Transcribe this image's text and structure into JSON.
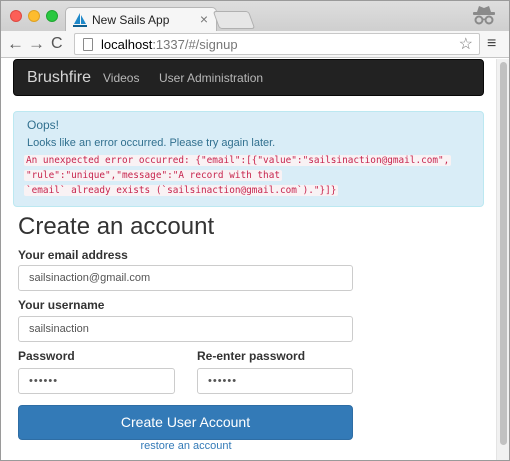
{
  "browser": {
    "tab_title": "New Sails App",
    "tab_close": "×",
    "url_host": "localhost",
    "url_rest": ":1337/#/signup",
    "back_icon": "←",
    "forward_icon": "→",
    "reload_icon": "C",
    "star_icon": "☆",
    "menu_icon": "≡"
  },
  "navbar": {
    "brand": "Brushfire",
    "items": [
      "Videos",
      "User Administration"
    ]
  },
  "alert": {
    "title": "Oops!",
    "message": "Looks like an error occurred. Please try again later.",
    "error_lines": [
      "An unexpected error occurred: {\"email\":[{\"value\":\"sailsinaction@gmail.com\",",
      "\"rule\":\"unique\",\"message\":\"A record with that",
      "`email` already exists (`sailsinaction@gmail.com`).\"}]}"
    ],
    "colors": {
      "background": "#d9edf7",
      "text": "#31708f",
      "code": "#c7254e"
    }
  },
  "form": {
    "title": "Create an account",
    "email_label": "Your email address",
    "email_value": "sailsinaction@gmail.com",
    "username_label": "Your username",
    "username_value": "sailsinaction",
    "password_label": "Password",
    "password_value": "••••••",
    "confirm_label": "Re-enter password",
    "confirm_value": "••••••",
    "submit_label": "Create User Account",
    "restore_link": "restore an account"
  },
  "colors": {
    "primary": "#337ab7",
    "navbar": "#222222"
  }
}
